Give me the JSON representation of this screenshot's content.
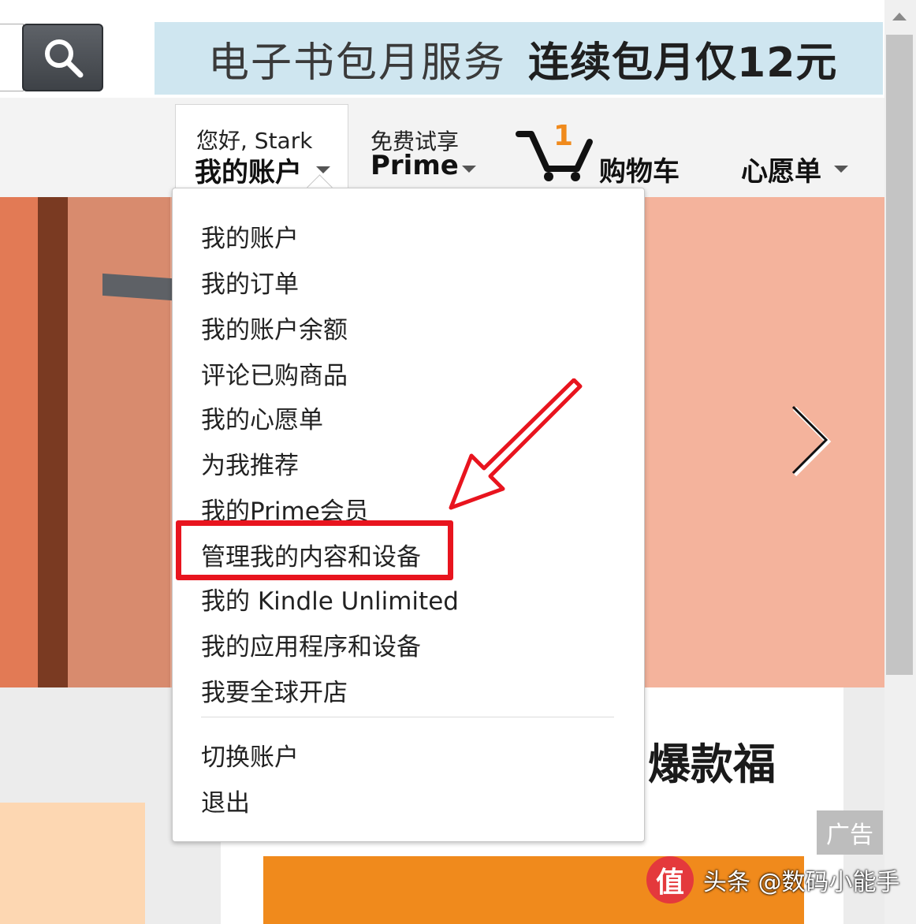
{
  "banner": {
    "text": "电子书包月服务",
    "promo": "连续包月仅12元"
  },
  "nav": {
    "account": {
      "greeting": "您好, Stark",
      "label": "我的账户"
    },
    "prime": {
      "small": "免费试享",
      "label": "Prime"
    },
    "cart": {
      "count": "1",
      "label": "购物车"
    },
    "wishlist": {
      "label": "心愿单"
    }
  },
  "dropdown": {
    "items": [
      "我的账户",
      "我的订单",
      "我的账户余额",
      "评论已购商品",
      "我的心愿单",
      "为我推荐",
      "我的Prime会员",
      "管理我的内容和设备",
      "我的 Kindle Unlimited",
      "我的应用程序和设备",
      "我要全球开店"
    ],
    "footer_items": [
      "切换账户",
      "退出"
    ]
  },
  "promo_card": {
    "title": "爆款福"
  },
  "ad_badge": "广告",
  "watermark": {
    "badge": "值",
    "text": "头条 @数码小能手"
  },
  "colors": {
    "highlight": "#e8141e",
    "banner_bg": "#cfe6f0",
    "hero_bg": "#f4b39c",
    "cart_badge": "#f08a1c"
  }
}
